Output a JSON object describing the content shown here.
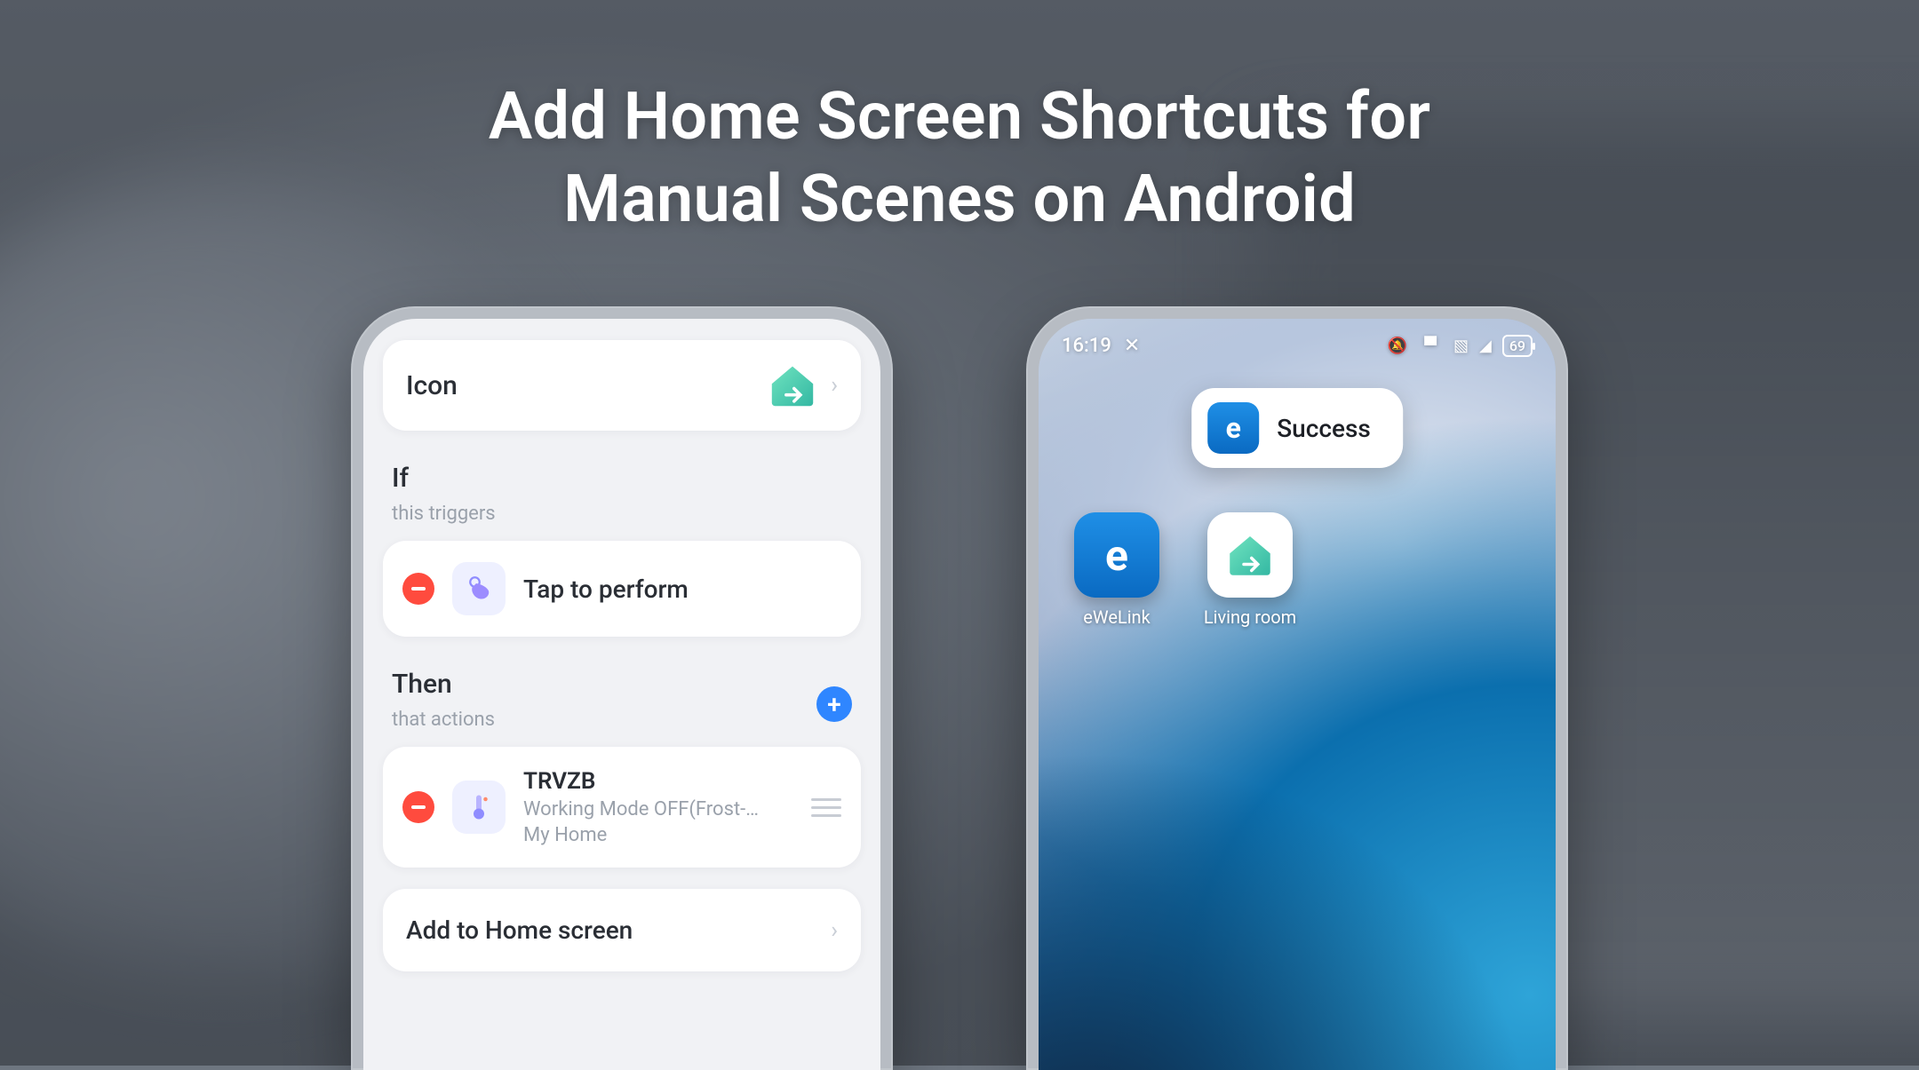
{
  "heading": {
    "line1": "Add Home Screen Shortcuts for",
    "line2": "Manual Scenes on Android"
  },
  "left_phone": {
    "icon_row": {
      "label": "Icon",
      "icon_name": "house-arrow-icon"
    },
    "if_section": {
      "title": "If",
      "subtitle": "this triggers"
    },
    "if_item": {
      "label": "Tap to perform",
      "icon_name": "tap-icon"
    },
    "then_section": {
      "title": "Then",
      "subtitle": "that actions"
    },
    "then_item": {
      "title": "TRVZB",
      "line2": "Working Mode OFF(Frost-…",
      "line3": "My Home",
      "icon_name": "thermometer-icon"
    },
    "add_row": {
      "label": "Add to Home screen"
    }
  },
  "right_phone": {
    "status": {
      "time": "16:19",
      "battery": "69"
    },
    "toast": {
      "text": "Success",
      "app_letter": "e"
    },
    "apps": [
      {
        "name": "eWeLink",
        "kind": "blue-e"
      },
      {
        "name": "Living room",
        "kind": "house"
      }
    ]
  }
}
